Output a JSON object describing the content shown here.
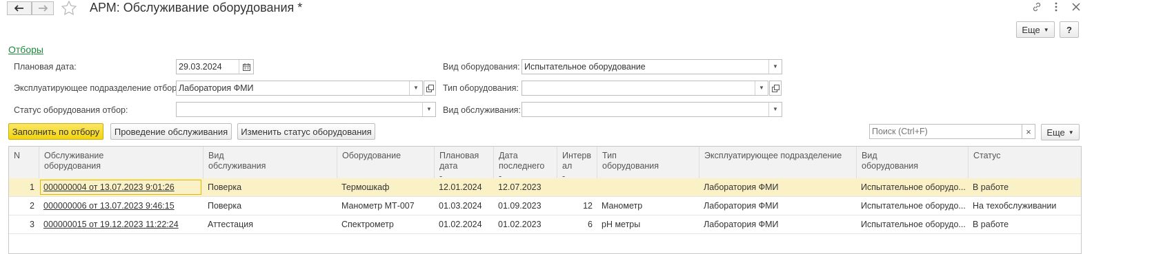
{
  "window": {
    "title": "АРМ: Обслуживание оборудования *",
    "more_label": "Еще",
    "help_label": "?"
  },
  "filters": {
    "toggle_label": "Отборы",
    "planned_date": {
      "label": "Плановая дата:",
      "value": "29.03.2024"
    },
    "department": {
      "label": "Эксплуатирующее подразделение отбор:",
      "value": "Лаборатория ФМИ"
    },
    "status": {
      "label": "Статус оборудования отбор:",
      "value": ""
    },
    "equipment_kind": {
      "label": "Вид оборудования:",
      "value": "Испытательное оборудование"
    },
    "equipment_type": {
      "label": "Тип оборудования:",
      "value": ""
    },
    "service_kind": {
      "label": "Вид обслуживания:",
      "value": ""
    }
  },
  "toolbar": {
    "fill_label": "Заполнить по отбору",
    "conduct_label": "Проведение обслуживания",
    "change_status_label": "Изменить статус оборудования",
    "search_placeholder": "Поиск (Ctrl+F)",
    "clear_label": "×",
    "more_label": "Еще"
  },
  "table": {
    "columns": [
      "N",
      "Обслуживание\nоборудования",
      "Вид\nобслуживания",
      "Оборудование",
      "Плановая\nдата\n-",
      "Дата\nпоследнего\n-",
      "Интерв\nал\n-",
      "Тип\nоборудования",
      "Эксплуатирующее подразделение",
      "Вид\nоборудования",
      "Статус"
    ],
    "rows": [
      [
        "1",
        "000000004 от 13.07.2023 9:01:26",
        "Поверка",
        "Термошкаф",
        "12.01.2024",
        "12.07.2023",
        "",
        "",
        "Лаборатория ФМИ",
        "Испытательное оборудо...",
        "В работе"
      ],
      [
        "2",
        "000000006 от 13.07.2023 9:46:15",
        "Поверка",
        "Манометр МТ-007",
        "01.03.2024",
        "01.09.2023",
        "12",
        "Манометр",
        "Лаборатория ФМИ",
        "Испытательное оборудо...",
        "На техобслуживании"
      ],
      [
        "3",
        "000000015 от 19.12.2023 11:22:24",
        "Аттестация",
        "Спектрометр",
        "01.02.2024",
        "01.02.2023",
        "6",
        "pH метры",
        "Лаборатория ФМИ",
        "Испытательное оборудо...",
        "В работе"
      ]
    ]
  },
  "colors": {
    "accent_yellow": "#f2d410",
    "selected_row": "#fbf1c6",
    "link_green": "#1c8a3e"
  }
}
